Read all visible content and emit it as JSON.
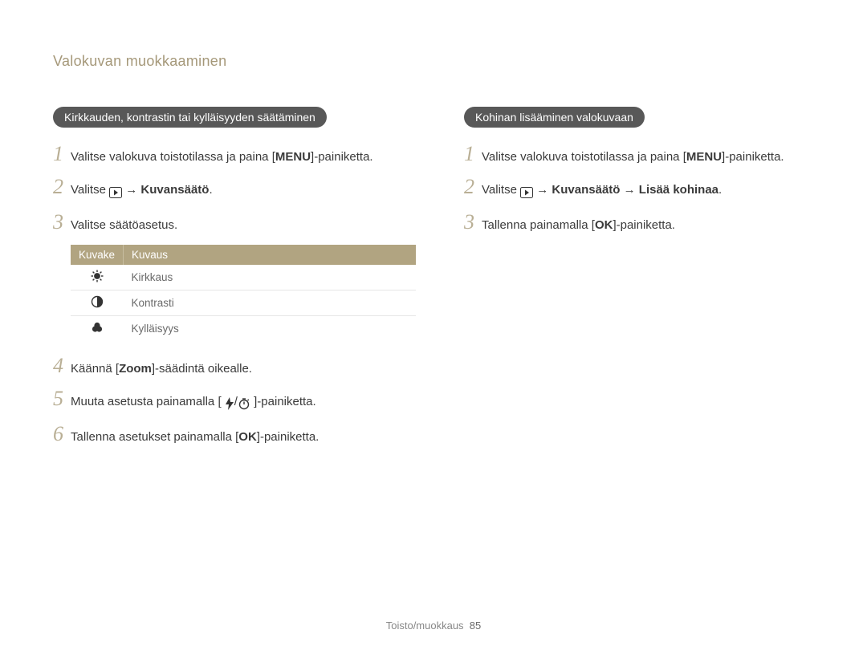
{
  "page_title": "Valokuvan muokkaaminen",
  "left": {
    "heading": "Kirkkauden, kontrastin tai kylläisyyden säätäminen",
    "steps": {
      "s1": {
        "num": "1",
        "prefix": "Valitse valokuva toistotilassa ja paina [",
        "menu": "MENU",
        "suffix": "]-painiketta."
      },
      "s2": {
        "num": "2",
        "prefix": "Valitse ",
        "arrow": "→",
        "bold1": "Kuvansäätö",
        "tail": "."
      },
      "s3": {
        "num": "3",
        "text": "Valitse säätöasetus."
      },
      "table": {
        "head_icon": "Kuvake",
        "head_desc": "Kuvaus",
        "rows": [
          {
            "icon": "brightness-icon",
            "desc": "Kirkkaus"
          },
          {
            "icon": "contrast-icon",
            "desc": "Kontrasti"
          },
          {
            "icon": "saturation-icon",
            "desc": "Kylläisyys"
          }
        ]
      },
      "s4": {
        "num": "4",
        "pre": "Käännä [",
        "bold": "Zoom",
        "post": "]-säädintä oikealle."
      },
      "s5": {
        "num": "5",
        "pre": "Muuta asetusta painamalla [",
        "slash": "/",
        "post": "]-painiketta."
      },
      "s6": {
        "num": "6",
        "pre": "Tallenna asetukset painamalla [",
        "ok": "OK",
        "post": "]-painiketta."
      }
    }
  },
  "right": {
    "heading": "Kohinan lisääminen valokuvaan",
    "steps": {
      "s1": {
        "num": "1",
        "prefix": "Valitse valokuva toistotilassa ja paina [",
        "menu": "MENU",
        "suffix": "]-painiketta."
      },
      "s2": {
        "num": "2",
        "prefix": "Valitse ",
        "arrow1": "→",
        "bold1": "Kuvansäätö",
        "arrow2": "→",
        "bold2": "Lisää kohinaa",
        "tail": "."
      },
      "s3": {
        "num": "3",
        "pre": "Tallenna painamalla [",
        "ok": "OK",
        "post": "]-painiketta."
      }
    }
  },
  "footer": {
    "section": "Toisto/muokkaus",
    "page": "85"
  }
}
